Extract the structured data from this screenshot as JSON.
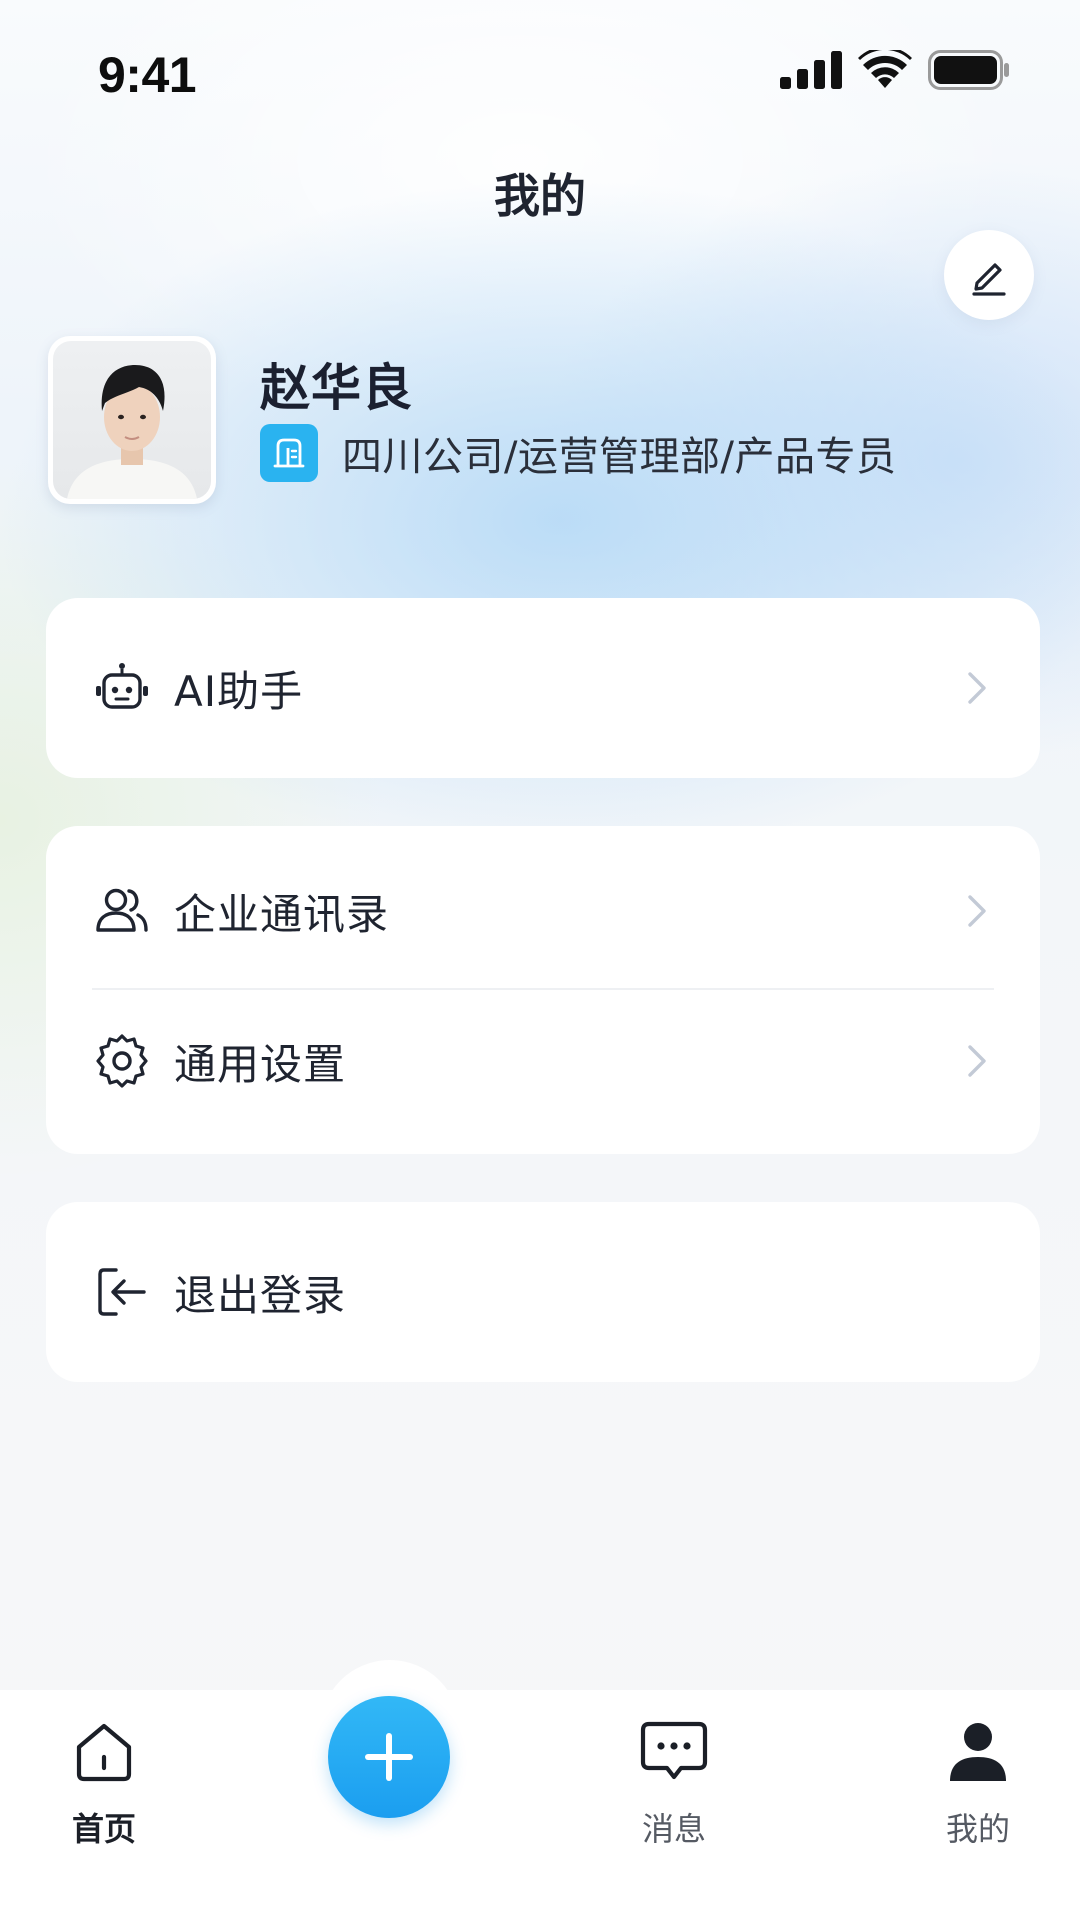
{
  "status_bar": {
    "time": "9:41"
  },
  "header": {
    "title": "我的"
  },
  "profile": {
    "name": "赵华良",
    "org_path": "四川公司/运营管理部/产品专员"
  },
  "menu": {
    "ai_assistant": "AI助手",
    "contacts": "企业通讯录",
    "settings": "通用设置",
    "logout": "退出登录"
  },
  "bottom_nav": {
    "home": "首页",
    "messages": "消息",
    "mine": "我的",
    "active": "home"
  },
  "icons": {
    "edit": "pencil-icon",
    "org": "building-icon",
    "ai": "robot-icon",
    "contacts": "users-icon",
    "settings": "gear-icon",
    "logout": "logout-icon",
    "chevron": "chevron-right-icon",
    "home": "home-icon",
    "add": "plus-icon",
    "messages": "chat-icon",
    "mine": "user-icon"
  },
  "colors": {
    "accent": "#1FA8F2",
    "text_primary": "#1F2430",
    "chevron": "#C3CAD6"
  }
}
